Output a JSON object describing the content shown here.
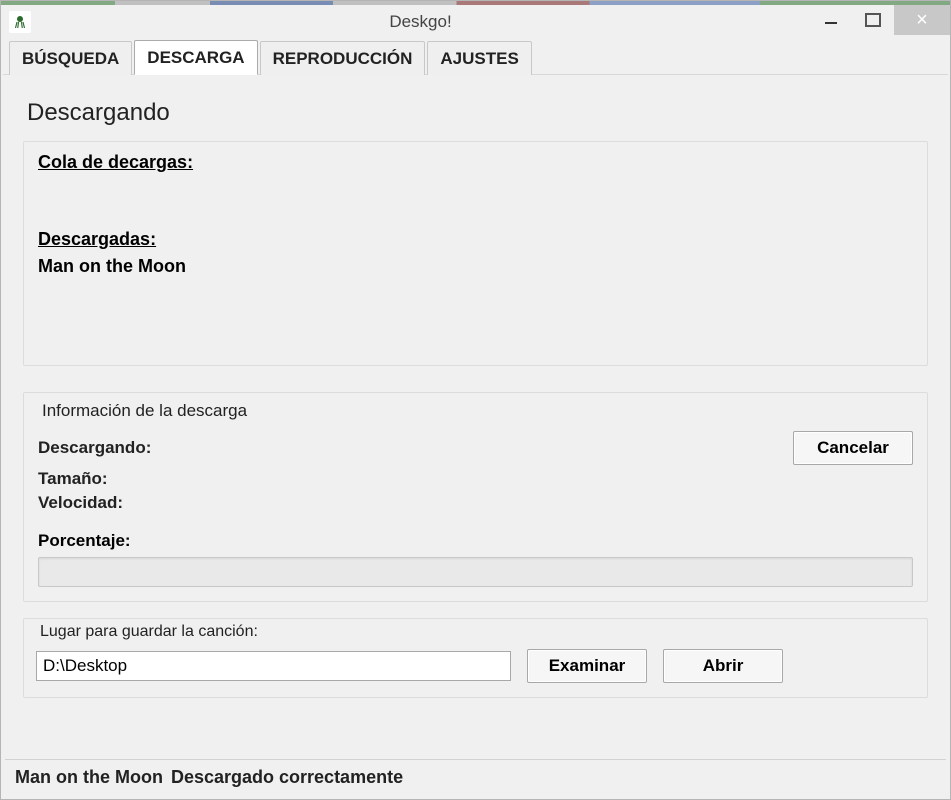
{
  "window": {
    "title": "Deskgo!"
  },
  "tabs": {
    "items": [
      {
        "label": "BÚSQUEDA"
      },
      {
        "label": "DESCARGA"
      },
      {
        "label": "REPRODUCCIÓN"
      },
      {
        "label": "AJUSTES"
      }
    ],
    "active_index": 1
  },
  "page": {
    "heading": "Descargando"
  },
  "queue": {
    "label": "Cola de decargas:",
    "downloaded_label": "Descargadas:",
    "downloaded_items": [
      "Man on the Moon"
    ]
  },
  "info": {
    "legend": "Información de la descarga",
    "downloading_label": "Descargando:",
    "size_label": "Tamaño:",
    "speed_label": "Velocidad:",
    "percent_label": "Porcentaje:",
    "cancel_button": "Cancelar"
  },
  "save": {
    "legend": "Lugar para guardar la canción:",
    "path": "D:\\Desktop",
    "browse_button": "Examinar",
    "open_button": "Abrir"
  },
  "status": {
    "name": "Man on the Moon",
    "message": "Descargado correctamente"
  }
}
